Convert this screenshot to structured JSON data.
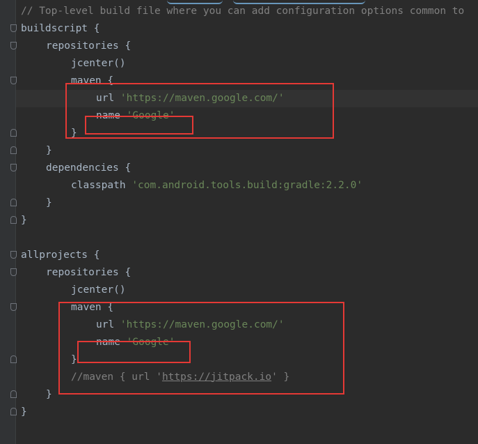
{
  "editor": {
    "lines": [
      {
        "indent": 0,
        "parts": [
          {
            "t": "comment",
            "v": "// Top-level build file where you can add configuration options common to"
          }
        ]
      },
      {
        "indent": 0,
        "parts": [
          {
            "t": "kw",
            "v": "buildscript {"
          }
        ]
      },
      {
        "indent": 1,
        "parts": [
          {
            "t": "kw",
            "v": "repositories {"
          }
        ]
      },
      {
        "indent": 2,
        "parts": [
          {
            "t": "kw",
            "v": "jcenter()"
          }
        ]
      },
      {
        "indent": 2,
        "parts": [
          {
            "t": "kw",
            "v": "maven {"
          }
        ]
      },
      {
        "indent": 3,
        "parts": [
          {
            "t": "kw",
            "v": "url "
          },
          {
            "t": "str",
            "v": "'https://maven.google.com/'"
          }
        ],
        "current": true
      },
      {
        "indent": 3,
        "parts": [
          {
            "t": "kw",
            "v": "name "
          },
          {
            "t": "str",
            "v": "'Google'"
          }
        ]
      },
      {
        "indent": 2,
        "parts": [
          {
            "t": "kw",
            "v": "}"
          }
        ]
      },
      {
        "indent": 1,
        "parts": [
          {
            "t": "kw",
            "v": "}"
          }
        ]
      },
      {
        "indent": 1,
        "parts": [
          {
            "t": "kw",
            "v": "dependencies {"
          }
        ]
      },
      {
        "indent": 2,
        "parts": [
          {
            "t": "kw",
            "v": "classpath "
          },
          {
            "t": "str",
            "v": "'com.android.tools.build:gradle:2.2.0'"
          }
        ]
      },
      {
        "indent": 1,
        "parts": [
          {
            "t": "kw",
            "v": "}"
          }
        ]
      },
      {
        "indent": 0,
        "parts": [
          {
            "t": "kw",
            "v": "}"
          }
        ]
      },
      {
        "indent": 0,
        "parts": []
      },
      {
        "indent": 0,
        "parts": [
          {
            "t": "kw",
            "v": "allprojects {"
          }
        ]
      },
      {
        "indent": 1,
        "parts": [
          {
            "t": "kw",
            "v": "repositories {"
          }
        ]
      },
      {
        "indent": 2,
        "parts": [
          {
            "t": "kw",
            "v": "jcenter()"
          }
        ]
      },
      {
        "indent": 2,
        "parts": [
          {
            "t": "kw",
            "v": "maven {"
          }
        ]
      },
      {
        "indent": 3,
        "parts": [
          {
            "t": "kw",
            "v": "url "
          },
          {
            "t": "str",
            "v": "'https://maven.google.com/'"
          }
        ]
      },
      {
        "indent": 3,
        "parts": [
          {
            "t": "kw",
            "v": "name "
          },
          {
            "t": "str",
            "v": "'Google'"
          }
        ]
      },
      {
        "indent": 2,
        "parts": [
          {
            "t": "kw",
            "v": "}"
          }
        ]
      },
      {
        "indent": 2,
        "parts": [
          {
            "t": "comment",
            "v": "//maven { url '"
          },
          {
            "t": "comment-url",
            "v": "https://jitpack.io"
          },
          {
            "t": "comment",
            "v": "' }"
          }
        ]
      },
      {
        "indent": 1,
        "parts": [
          {
            "t": "kw",
            "v": "}"
          }
        ]
      },
      {
        "indent": 0,
        "parts": [
          {
            "t": "kw",
            "v": "}"
          }
        ]
      }
    ],
    "colors": {
      "background": "#2b2b2b",
      "gutter": "#313335",
      "text": "#a9b7c6",
      "string": "#6a8759",
      "comment": "#808080",
      "highlight_box": "#e53935",
      "current_line": "#323232"
    }
  }
}
